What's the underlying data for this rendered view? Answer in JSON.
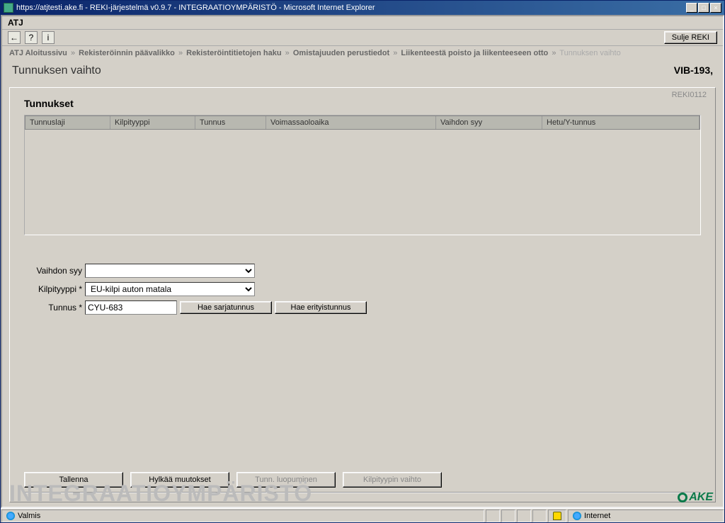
{
  "window": {
    "title": "https://atjtesti.ake.fi - REKI-järjestelmä v0.9.7 - INTEGRAATIOYMPÄRISTÖ - Microsoft Internet Explorer"
  },
  "menubar": {
    "app": "ATJ"
  },
  "toolbar": {
    "close_btn": "Sulje REKI"
  },
  "breadcrumb": {
    "items": [
      "ATJ Aloitussivu",
      "Rekisteröinnin päävalikko",
      "Rekisteröintitietojen haku",
      "Omistajuuden perustiedot",
      "Liikenteestä poisto ja liikenteeseen otto",
      "Tunnuksen vaihto"
    ],
    "sep": "»"
  },
  "page": {
    "title": "Tunnuksen vaihto",
    "right": "VIB-193,",
    "code": "REKI0112",
    "section": "Tunnukset"
  },
  "table": {
    "headers": [
      "Tunnuslaji",
      "Kilpityyppi",
      "Tunnus",
      "Voimassaoloaika",
      "Vaihdon syy",
      "Hetu/Y-tunnus"
    ]
  },
  "form": {
    "reason_label": "Vaihdon syy",
    "reason_value": "",
    "platetype_label": "Kilpityyppi *",
    "platetype_value": "EU-kilpi auton matala",
    "tunnus_label": "Tunnus *",
    "tunnus_value": "CYU-683",
    "btn_serial": "Hae sarjatunnus",
    "btn_special": "Hae erityistunnus"
  },
  "actions": {
    "save": "Tallenna",
    "discard": "Hylkää muutokset",
    "giveup": "Tunn. luopuminen",
    "platechange": "Kilpityypin vaihto"
  },
  "footer": {
    "watermark": "INTEGRAATIOYMPÄRISTÖ",
    "logo": "AKE"
  },
  "statusbar": {
    "ready": "Valmis",
    "zone": "Internet"
  }
}
